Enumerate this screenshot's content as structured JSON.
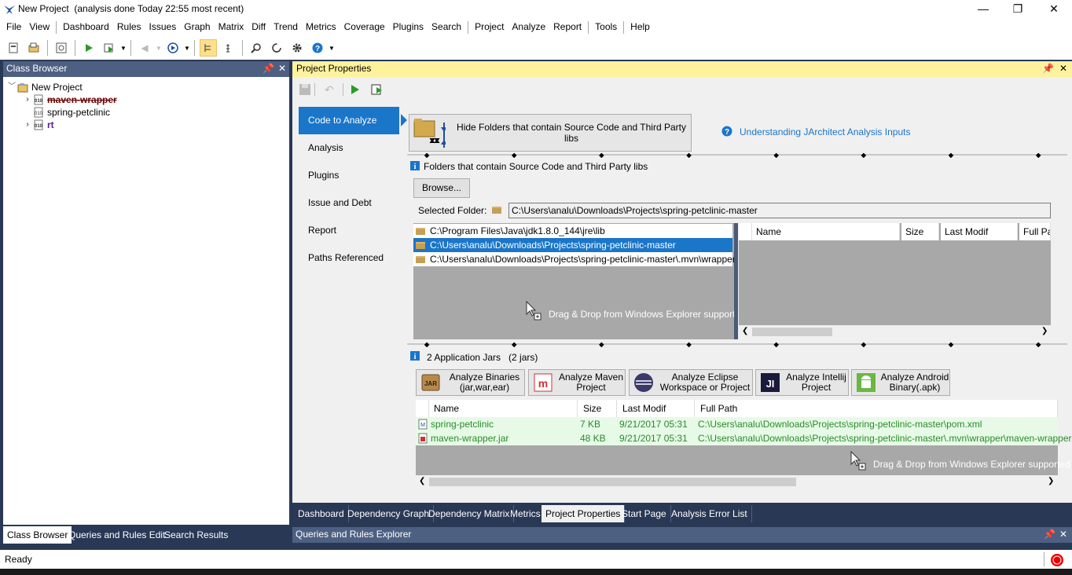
{
  "window": {
    "title": "New Project  (analysis done Today 22:55 most recent)",
    "minimize": "—",
    "restore": "❐",
    "close": "✕"
  },
  "menu": [
    "File",
    "View",
    "Dashboard",
    "Rules",
    "Issues",
    "Graph",
    "Matrix",
    "Diff",
    "Trend",
    "Metrics",
    "Coverage",
    "Plugins",
    "Search",
    "Project",
    "Analyze",
    "Report",
    "Tools",
    "Help"
  ],
  "class_browser": {
    "title": "Class Browser",
    "items": [
      "New Project",
      "maven-wrapper",
      "spring-petclinic",
      "rt"
    ]
  },
  "left_tabs": [
    "Class Browser",
    "Queries and Rules Edit",
    "Search Results"
  ],
  "project_properties": {
    "title": "Project Properties",
    "nav": [
      "Code to Analyze",
      "Analysis",
      "Plugins",
      "Issue and Debt",
      "Report",
      "Paths Referenced"
    ],
    "hide_folders_label": "Hide Folders that contain Source Code and Third Party libs",
    "help_link": "Understanding JArchitect Analysis Inputs",
    "folders_section_label": "Folders that contain Source Code and Third Party libs",
    "browse_label": "Browse...",
    "selected_folder_label": "Selected Folder:",
    "selected_folder_value": "C:\\Users\\analu\\Downloads\\Projects\\spring-petclinic-master",
    "folders": [
      "C:\\Program Files\\Java\\jdk1.8.0_144\\jre\\lib",
      "C:\\Users\\analu\\Downloads\\Projects\\spring-petclinic-master",
      "C:\\Users\\analu\\Downloads\\Projects\\spring-petclinic-master\\.mvn\\wrapper"
    ],
    "drag_drop_text": "Drag & Drop from Windows Explorer supported",
    "file_columns": [
      "Name",
      "Size",
      "Last Modif",
      "Full Pat"
    ],
    "jars_label": "2 Application Jars   (2 jars)",
    "analyze_buttons": [
      {
        "line1": "Analyze Binaries",
        "line2": "(jar,war,ear)"
      },
      {
        "line1": "Analyze Maven",
        "line2": "Project"
      },
      {
        "line1": "Analyze Eclipse",
        "line2": "Workspace or Project"
      },
      {
        "line1": "Analyze Intellij",
        "line2": "Project"
      },
      {
        "line1": "Analyze Android",
        "line2": "Binary(.apk)"
      }
    ],
    "jar_columns": [
      "Name",
      "Size",
      "Last Modif",
      "Full Path"
    ],
    "jars": [
      {
        "name": "spring-petclinic",
        "size": "7 KB",
        "modified": "9/21/2017 05:31",
        "path": "C:\\Users\\analu\\Downloads\\Projects\\spring-petclinic-master\\pom.xml"
      },
      {
        "name": "maven-wrapper.jar",
        "size": "48 KB",
        "modified": "9/21/2017 05:31",
        "path": "C:\\Users\\analu\\Downloads\\Projects\\spring-petclinic-master\\.mvn\\wrapper\\maven-wrapper.jar"
      }
    ]
  },
  "doc_tabs": [
    "Dashboard",
    "Dependency Graph",
    "Dependency Matrix",
    "Metrics",
    "Project Properties",
    "Start Page",
    "Analysis Error List"
  ],
  "queries_explorer": "Queries and Rules Explorer",
  "status": "Ready",
  "colors": {
    "accent": "#1a76c8",
    "dock": "#293955",
    "header_yellow": "#fff29d",
    "jar_green": "#2a8a2a"
  }
}
